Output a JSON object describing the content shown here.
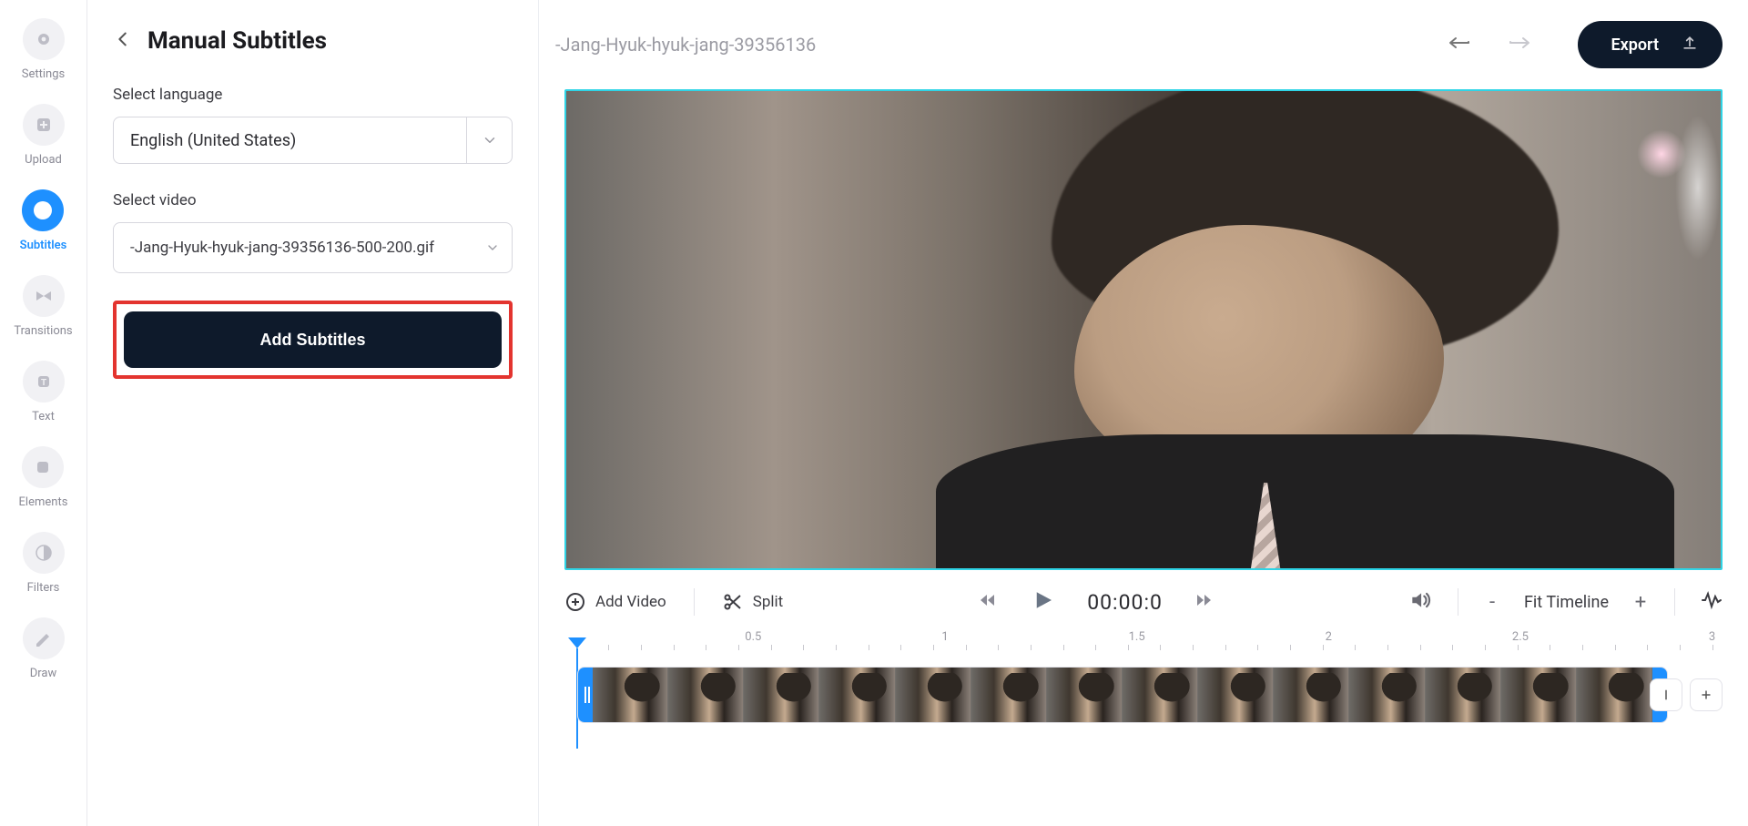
{
  "nav": {
    "items": [
      {
        "id": "settings",
        "label": "Settings",
        "active": false
      },
      {
        "id": "upload",
        "label": "Upload",
        "active": false
      },
      {
        "id": "subtitles",
        "label": "Subtitles",
        "active": true
      },
      {
        "id": "transitions",
        "label": "Transitions",
        "active": false
      },
      {
        "id": "text",
        "label": "Text",
        "active": false
      },
      {
        "id": "elements",
        "label": "Elements",
        "active": false
      },
      {
        "id": "filters",
        "label": "Filters",
        "active": false
      },
      {
        "id": "draw",
        "label": "Draw",
        "active": false
      }
    ]
  },
  "panel": {
    "title": "Manual Subtitles",
    "select_language_label": "Select language",
    "selected_language": "English (United States)",
    "select_video_label": "Select video",
    "selected_video": "-Jang-Hyuk-hyuk-jang-39356136-500-200.gif",
    "add_subtitles_label": "Add Subtitles"
  },
  "topbar": {
    "project_title": "-Jang-Hyuk-hyuk-jang-39356136",
    "export_label": "Export"
  },
  "timeline": {
    "add_video_label": "Add Video",
    "split_label": "Split",
    "timecode": "00:00:0",
    "fit_timeline_label": "Fit Timeline",
    "zoom_minus": "-",
    "zoom_plus": "+",
    "ruler_ticks": [
      "0.5",
      "1",
      "1.5",
      "2",
      "2.5",
      "3"
    ]
  },
  "colors": {
    "accent": "#1E90FF",
    "dark": "#0E1A2B",
    "highlight_border": "#E3342F",
    "preview_border": "#2fd4e6"
  }
}
